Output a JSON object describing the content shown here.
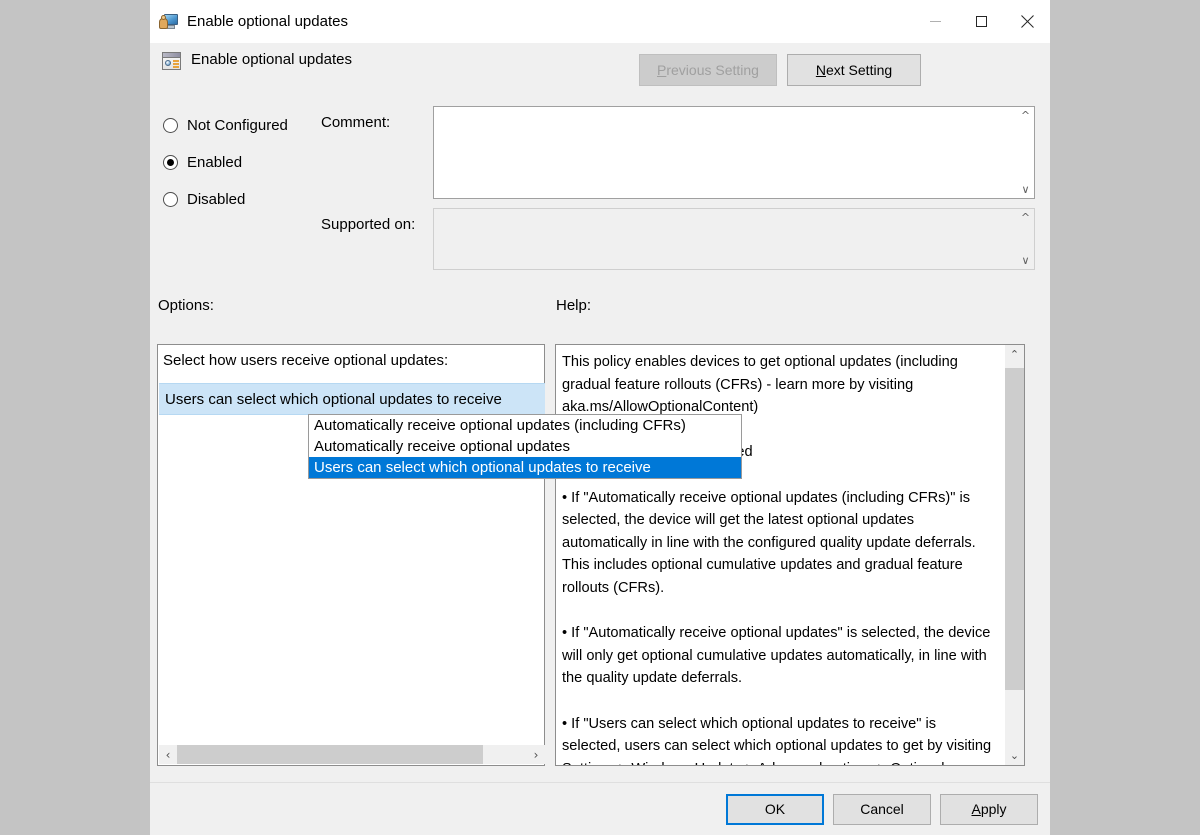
{
  "window": {
    "title": "Enable optional updates",
    "title_icon": "policy-computer-icon",
    "controls": {
      "minimize": "minimize-icon",
      "maximize": "maximize-icon",
      "close": "close-icon"
    }
  },
  "header": {
    "icon": "policy-setting-icon",
    "title": "Enable optional updates",
    "previous_setting": "Previous Setting",
    "previous_setting_disabled": true,
    "next_setting": "Next Setting"
  },
  "state": {
    "radios": [
      {
        "label": "Not Configured",
        "selected": false
      },
      {
        "label": "Enabled",
        "selected": true
      },
      {
        "label": "Disabled",
        "selected": false
      }
    ],
    "comment_label": "Comment:",
    "comment_value": "",
    "supported_label": "Supported on:",
    "supported_value": ""
  },
  "sections": {
    "options_label": "Options:",
    "help_label": "Help:"
  },
  "options": {
    "caption": "Select how users receive optional updates:",
    "selected_value": "Users can select which optional updates to receive",
    "dropdown_open": true,
    "items": [
      "Automatically receive optional updates (including CFRs)",
      "Automatically receive optional updates",
      "Users can select which optional updates to receive"
    ],
    "highlighted_index": 2,
    "hscroll": {
      "left_arrow": "‹",
      "right_arrow": "›"
    }
  },
  "help": {
    "text": "This policy enables devices to get optional updates (including gradual feature rollouts (CFRs) - learn more by visiting aka.ms/AllowOptionalContent)\n\nWhen the policy is configured\n\n• If \"Automatically receive optional updates (including CFRs)\" is selected, the device will get the latest optional updates automatically in line with the configured quality update deferrals. This includes optional cumulative updates and gradual feature rollouts (CFRs).\n\n• If \"Automatically receive optional updates\" is selected, the device will only get optional cumulative updates automatically, in line with the quality update deferrals.\n\n• If \"Users can select which optional updates to receive\" is selected, users can select which optional updates to get by visiting Settings > Windows Update > Advanced options > Optional updates. Users can also enable the toggle \"Get the latest updates as soon",
    "scroll_up_arrow": "⌃",
    "scroll_down_arrow": "⌄"
  },
  "footer": {
    "ok": "OK",
    "cancel": "Cancel",
    "apply": "Apply"
  },
  "colors": {
    "desktop_background": "#c4c4c4",
    "dialog_background": "#f0f0f0",
    "titlebar_background": "#ffffff",
    "accent_blue": "#0078d7",
    "combo_light_blue": "#cce4f7",
    "scrollbar_thumb": "#cdcdcd",
    "disabled_text": "#a0a0a0"
  }
}
